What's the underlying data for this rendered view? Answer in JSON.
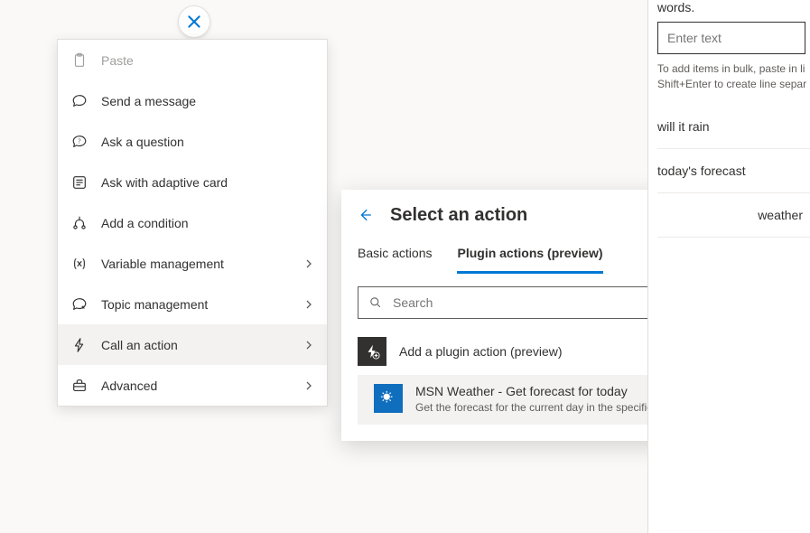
{
  "contextMenu": {
    "items": [
      {
        "label": "Paste",
        "hasSubmenu": false,
        "disabled": true
      },
      {
        "label": "Send a message",
        "hasSubmenu": false
      },
      {
        "label": "Ask a question",
        "hasSubmenu": false
      },
      {
        "label": "Ask with adaptive card",
        "hasSubmenu": false
      },
      {
        "label": "Add a condition",
        "hasSubmenu": false
      },
      {
        "label": "Variable management",
        "hasSubmenu": true
      },
      {
        "label": "Topic management",
        "hasSubmenu": true
      },
      {
        "label": "Call an action",
        "hasSubmenu": true,
        "selected": true
      },
      {
        "label": "Advanced",
        "hasSubmenu": true
      }
    ]
  },
  "actionPanel": {
    "title": "Select an action",
    "tabs": [
      {
        "label": "Basic actions",
        "active": false
      },
      {
        "label": "Plugin actions (preview)",
        "active": true
      }
    ],
    "searchPlaceholder": "Search",
    "addItem": {
      "title": "Add a plugin action (preview)"
    },
    "results": [
      {
        "title": "MSN Weather - Get forecast for today",
        "description": "Get the forecast for the current day in the specified location."
      }
    ]
  },
  "sidePanel": {
    "topText": "words.",
    "enterPlaceholder": "Enter text",
    "helper": "To add items in bulk, paste in li Shift+Enter to create line separ",
    "phrases": [
      "will it rain",
      "today's forecast",
      "weather"
    ]
  }
}
